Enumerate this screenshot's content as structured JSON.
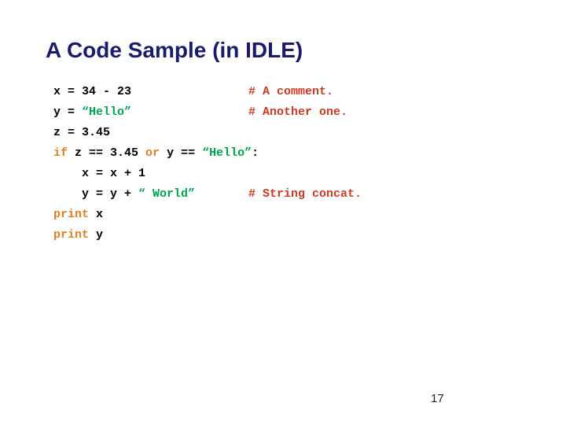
{
  "slide": {
    "title": "A Code Sample (in IDLE)",
    "page_number": "17",
    "background_color": "#ffffff",
    "title_color": "#1a1a6e"
  },
  "syntax_colors": {
    "plain": "#000000",
    "keyword": "#e08020",
    "string": "#00a550",
    "comment": "#cc3a20"
  },
  "code": {
    "language": "python",
    "lines": [
      {
        "tokens": [
          {
            "text": "x = 34 ",
            "kind": "plain"
          },
          {
            "text": "- 23",
            "kind": "plain"
          }
        ],
        "comment": "# A comment."
      },
      {
        "tokens": [
          {
            "text": "y = ",
            "kind": "plain"
          },
          {
            "text": "“Hello”",
            "kind": "string"
          }
        ],
        "comment": "# Another one."
      },
      {
        "tokens": [
          {
            "text": "z = 3.45",
            "kind": "plain"
          }
        ],
        "comment": ""
      },
      {
        "tokens": [
          {
            "text": "if",
            "kind": "keyword"
          },
          {
            "text": " z == 3.45 ",
            "kind": "plain"
          },
          {
            "text": "or",
            "kind": "keyword"
          },
          {
            "text": " y == ",
            "kind": "plain"
          },
          {
            "text": "“Hello”",
            "kind": "string"
          },
          {
            "text": ":",
            "kind": "plain"
          }
        ],
        "comment": ""
      },
      {
        "tokens": [
          {
            "text": "    x = x + 1",
            "kind": "plain"
          }
        ],
        "comment": ""
      },
      {
        "tokens": [
          {
            "text": "    y = y + ",
            "kind": "plain"
          },
          {
            "text": "“ World”",
            "kind": "string"
          }
        ],
        "comment": "# String concat."
      },
      {
        "tokens": [
          {
            "text": "print",
            "kind": "keyword"
          },
          {
            "text": " x",
            "kind": "plain"
          }
        ],
        "comment": ""
      },
      {
        "tokens": [
          {
            "text": "print",
            "kind": "keyword"
          },
          {
            "text": " y",
            "kind": "plain"
          }
        ],
        "comment": ""
      }
    ]
  }
}
